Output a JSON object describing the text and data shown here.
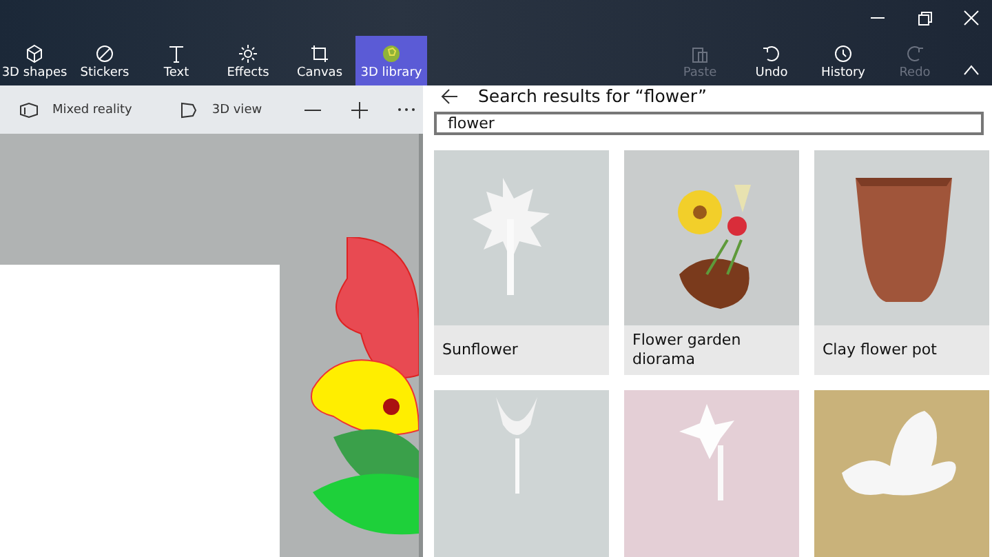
{
  "ribbon": {
    "tools": [
      {
        "label": "3D shapes",
        "selected": false
      },
      {
        "label": "Stickers",
        "selected": false
      },
      {
        "label": "Text",
        "selected": false
      },
      {
        "label": "Effects",
        "selected": false
      },
      {
        "label": "Canvas",
        "selected": false
      },
      {
        "label": "3D library",
        "selected": true
      }
    ],
    "actions": [
      {
        "label": "Paste",
        "disabled": true
      },
      {
        "label": "Undo",
        "disabled": false
      },
      {
        "label": "History",
        "disabled": false
      },
      {
        "label": "Redo",
        "disabled": true
      }
    ]
  },
  "subbar": {
    "items": [
      {
        "label": "Mixed reality"
      },
      {
        "label": "3D view"
      }
    ]
  },
  "panel": {
    "title": "Search results for “flower”",
    "search": {
      "value": "flower"
    },
    "results": [
      {
        "title": "Sunflower",
        "kind": "picture"
      },
      {
        "title": "Flower garden diorama",
        "kind": "picture"
      },
      {
        "title": "Clay flower pot",
        "kind": "picture"
      },
      {
        "kind": "picture"
      },
      {
        "kind": "picture"
      },
      {
        "kind": "picture"
      }
    ]
  }
}
